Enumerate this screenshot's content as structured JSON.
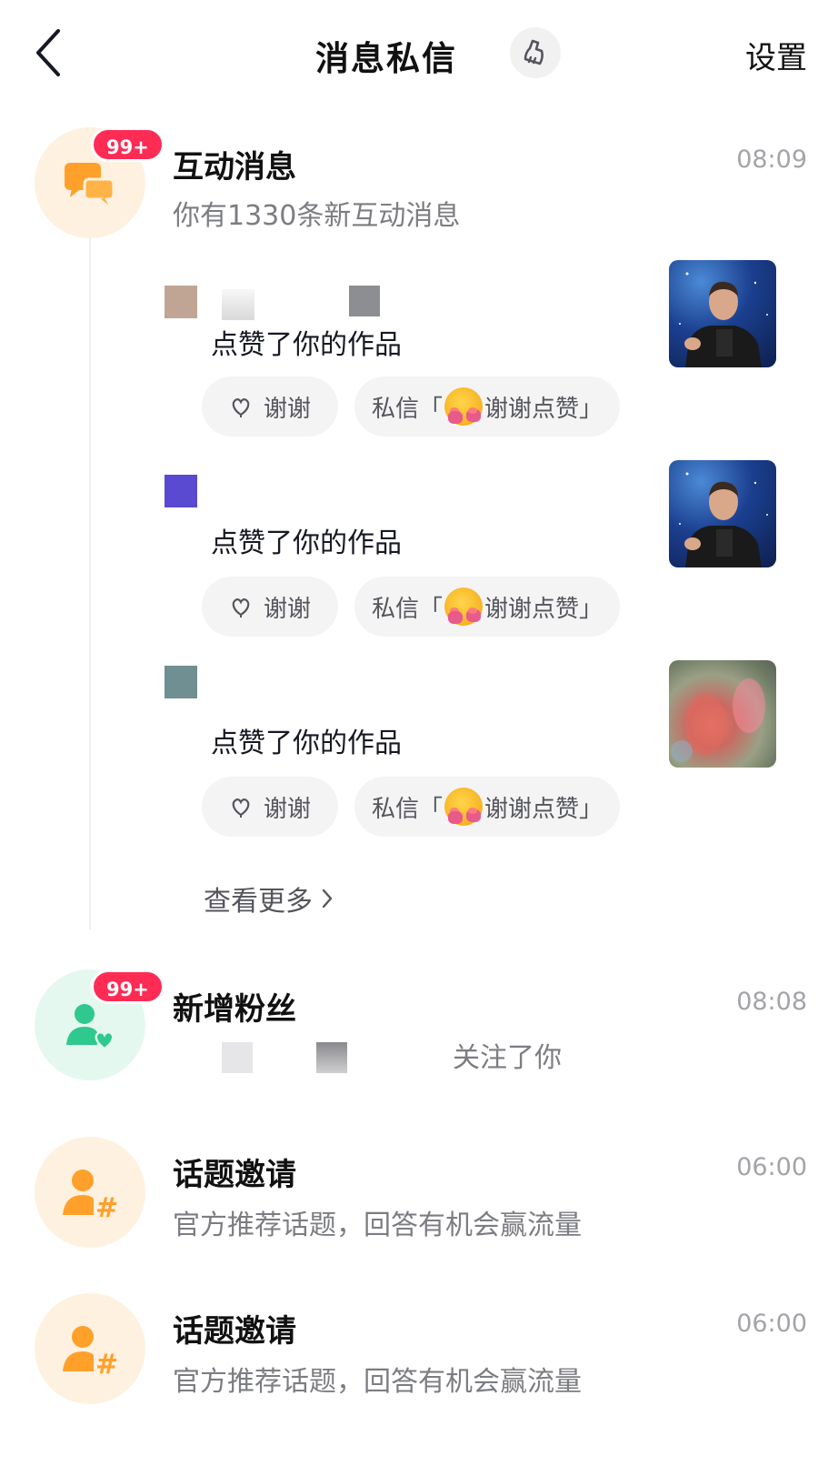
{
  "header": {
    "title": "消息私信",
    "settings_label": "设置"
  },
  "interactions": {
    "title": "互动消息",
    "badge": "99+",
    "subtitle": "你有1330条新互动消息",
    "time": "08:09",
    "items": [
      {
        "action": "点赞了你的作品",
        "thanks_label": "谢谢",
        "dm_prefix": "私信「",
        "dm_text": "谢谢点赞」",
        "avatar_color": "#c0a595",
        "thumb_icon": "photo-thumbnail"
      },
      {
        "action": "点赞了你的作品",
        "thanks_label": "谢谢",
        "dm_prefix": "私信「",
        "dm_text": "谢谢点赞」",
        "avatar_color": "#5a4ad1",
        "thumb_icon": "photo-thumbnail"
      },
      {
        "action": "点赞了你的作品",
        "thanks_label": "谢谢",
        "dm_prefix": "私信「",
        "dm_text": "谢谢点赞」",
        "avatar_color": "#6f8f92",
        "thumb_icon": "photo-thumbnail"
      }
    ],
    "see_more": "查看更多"
  },
  "new_fans": {
    "title": "新增粉丝",
    "badge": "99+",
    "subtitle": "关注了你",
    "time": "08:08"
  },
  "topic_invites": [
    {
      "title": "话题邀请",
      "subtitle": "官方推荐话题，回答有机会赢流量",
      "time": "06:00"
    },
    {
      "title": "话题邀请",
      "subtitle": "官方推荐话题，回答有机会赢流量",
      "time": "06:00"
    }
  ],
  "colors": {
    "badge": "#fe2c55",
    "orange_icon": "#ffa02a",
    "green_icon": "#2fc88f"
  }
}
